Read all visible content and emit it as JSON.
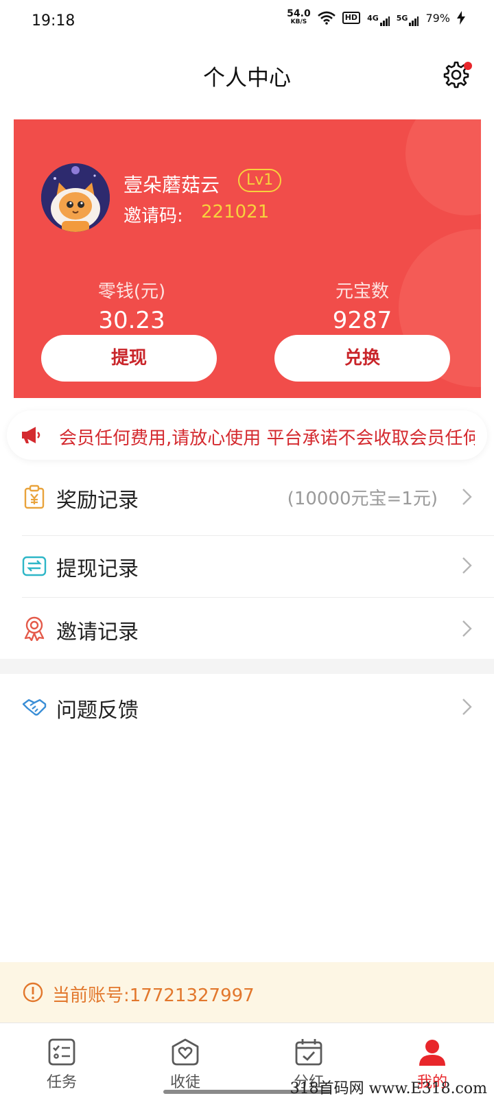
{
  "status_bar": {
    "time": "19:18",
    "speed_value": "54.0",
    "speed_unit": "KB/S",
    "hd": "HD",
    "net1": "4G",
    "net2": "5G",
    "battery": "79%"
  },
  "header": {
    "title": "个人中心",
    "settings_icon": "gear-icon"
  },
  "profile": {
    "username": "壹朵蘑菇云",
    "level": "Lv1",
    "invite_label": "邀请码:",
    "invite_code": "221021"
  },
  "wallet": {
    "change_label": "零钱(元)",
    "change_value": "30.23",
    "coins_label": "元宝数",
    "coins_value": "9287",
    "withdraw_button": "提现",
    "exchange_button": "兑换"
  },
  "notice": {
    "icon": "megaphone-icon",
    "text": "会员任何费用,请放心使用  平台承诺不会收取会员任何费用,请放心使用"
  },
  "menu": [
    {
      "label": "奖励记录",
      "hint": "(10000元宝=1元)",
      "icon": "reward-icon"
    },
    {
      "label": "提现记录",
      "hint": "",
      "icon": "wallet-icon"
    },
    {
      "label": "邀请记录",
      "hint": "",
      "icon": "medal-icon"
    },
    {
      "label": "问题反馈",
      "hint": "",
      "icon": "handshake-icon"
    }
  ],
  "account": {
    "text": "当前账号:17721327997"
  },
  "bottom_nav": [
    {
      "label": "任务",
      "icon": "task-icon",
      "active": false
    },
    {
      "label": "收徒",
      "icon": "heart-box-icon",
      "active": false
    },
    {
      "label": "分红",
      "icon": "calendar-check-icon",
      "active": false
    },
    {
      "label": "我的",
      "icon": "user-icon",
      "active": true
    }
  ],
  "watermark": "318首码网 www.E318.com",
  "colors": {
    "card_red": "#f14d4a",
    "accent_red": "#e8262b",
    "gold": "#f7d23d",
    "account_orange": "#e2772c",
    "account_bg": "#fdf6e4"
  }
}
